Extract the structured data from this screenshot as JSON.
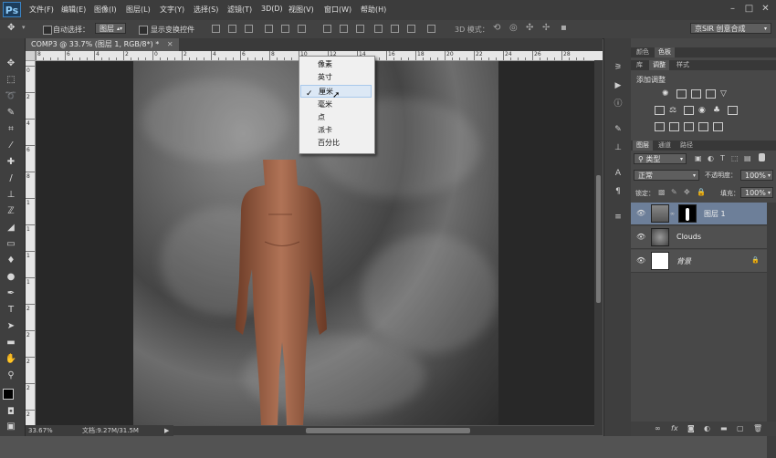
{
  "app": {
    "logo": "Ps"
  },
  "menubar": {
    "items": [
      "文件(F)",
      "编辑(E)",
      "图像(I)",
      "图层(L)",
      "文字(Y)",
      "选择(S)",
      "滤镜(T)",
      "3D(D)",
      "视图(V)",
      "窗口(W)",
      "帮助(H)"
    ],
    "window_controls": [
      "minimize",
      "maximize",
      "close"
    ]
  },
  "options_bar": {
    "auto_select_label": "自动选择：",
    "auto_select_target": "图层",
    "show_transform_label": "显示变换控件",
    "mode_3d_label": "3D 模式：",
    "workspace": "京SIR 创意合成"
  },
  "document": {
    "tab_title": "COMP3 @ 33.7% (图层 1, RGB/8*) *",
    "zoom": "33.67%",
    "doc_info": "文档:9.27M/31.5M"
  },
  "rulers": {
    "top_numbers": [
      "8",
      "6",
      "4",
      "2",
      "0",
      "2",
      "4",
      "6",
      "8",
      "10",
      "12",
      "14",
      "16",
      "18",
      "20",
      "22",
      "24",
      "26",
      "28"
    ],
    "left_numbers": [
      "0",
      "2",
      "4",
      "6",
      "8",
      "1",
      "1",
      "1",
      "1",
      "2",
      "2",
      "2",
      "2",
      "2"
    ]
  },
  "units_menu": {
    "items": [
      "像素",
      "英寸",
      "厘米",
      "毫米",
      "点",
      "派卡",
      "百分比"
    ],
    "selected": "厘米",
    "check": "✓"
  },
  "tools": [
    "move-tool",
    "marquee-tool",
    "lasso-tool",
    "quick-select-tool",
    "crop-tool",
    "eyedropper-tool",
    "healing-tool",
    "brush-tool",
    "clone-stamp-tool",
    "history-brush-tool",
    "eraser-tool",
    "gradient-tool",
    "blur-tool",
    "dodge-tool",
    "pen-tool",
    "type-tool",
    "path-select-tool",
    "shape-tool",
    "hand-tool",
    "zoom-tool"
  ],
  "panels": {
    "color_tabs": [
      "颜色",
      "色板"
    ],
    "adjust_tabs": [
      "库",
      "调整",
      "样式"
    ],
    "adjust_title": "添加调整",
    "layers_tabs": [
      "图层",
      "通道",
      "路径"
    ],
    "filter_kind": "类型",
    "blend_mode": "正常",
    "opacity_label": "不透明度：",
    "opacity": "100%",
    "lock_label": "锁定：",
    "fill_label": "填充：",
    "fill": "100%",
    "layers": [
      {
        "name": "图层 1",
        "selected": true
      },
      {
        "name": "Clouds",
        "selected": false
      },
      {
        "name": "背景",
        "selected": false,
        "locked": true
      }
    ],
    "footer_buttons": [
      "link-icon",
      "fx-icon",
      "mask-icon",
      "adjustment-icon",
      "folder-icon",
      "new-layer-icon",
      "trash-icon"
    ]
  },
  "colors": {
    "menubar": "#3c3c3c",
    "panel": "#484848",
    "selected_layer": "#6d7f99",
    "accent": "#3a83c4"
  }
}
